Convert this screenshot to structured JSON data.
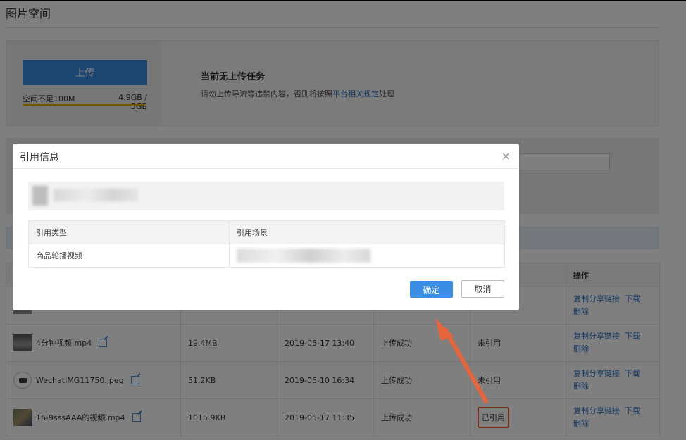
{
  "page": {
    "title": "图片空间"
  },
  "upload": {
    "button_label": "上传",
    "quota_label": "空间不足100M",
    "quota_value": "4.9GB / 5GB",
    "quota_fraction": 0.98,
    "status_title": "当前无上传任务",
    "notice_prefix": "请勿上传导流等违禁内容，否则将按照",
    "notice_link": "平台相关规定",
    "notice_suffix": "处理"
  },
  "table": {
    "op_header": "操作",
    "rows": [
      {
        "name": "4分钟视频.mp4",
        "size": "19.4MB",
        "time": "2019-05-17 13:40",
        "status": "上传成功",
        "ref": "未引用",
        "op_copy": "复制分享链接",
        "op_download": "下载",
        "op_delete": "删除"
      },
      {
        "name": "WechatIMG11750.jpeg",
        "size": "51.2KB",
        "time": "2019-05-10 16:34",
        "status": "上传成功",
        "ref": "未引用",
        "op_copy": "复制分享链接",
        "op_download": "下载",
        "op_delete": "删除"
      },
      {
        "name": "16-9sssAAA的视频.mp4",
        "size": "1015.9KB",
        "time": "2019-05-17 11:35",
        "status": "上传成功",
        "ref": "已引用",
        "op_copy": "复制分享链接",
        "op_download": "下载",
        "op_delete": "删除"
      }
    ],
    "first_row_ops": {
      "op_copy": "复制分享链接",
      "op_download": "下载",
      "op_delete": "删除"
    }
  },
  "modal": {
    "title": "引用信息",
    "close_glyph": "×",
    "col_type": "引用类型",
    "col_scene": "引用场景",
    "row_type": "商品轮播视频",
    "confirm_label": "确定",
    "cancel_label": "取消"
  },
  "colors": {
    "primary": "#3a8ee6",
    "link": "#2d6fc2",
    "highlight": "#e8643a",
    "quota_bar": "#f0a30a"
  }
}
